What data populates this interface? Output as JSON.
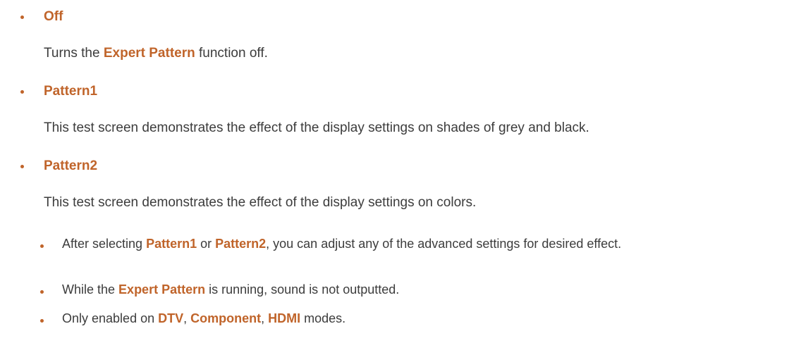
{
  "options": [
    {
      "title": "Off",
      "desc_pre": "Turns the ",
      "desc_hl": "Expert Pattern",
      "desc_post": " function off."
    },
    {
      "title": "Pattern1",
      "desc": "This test screen demonstrates the effect of the display settings on shades of grey and black."
    },
    {
      "title": "Pattern2",
      "desc": "This test screen demonstrates the effect of the display settings on colors."
    }
  ],
  "notes": [
    {
      "pre": "After selecting ",
      "hl1": "Pattern1",
      "mid": " or ",
      "hl2": "Pattern2",
      "post": ", you can adjust any of the advanced settings for desired effect."
    },
    {
      "pre": "While the ",
      "hl": "Expert Pattern",
      "post": " is running, sound is not outputted."
    },
    {
      "pre": "Only enabled on ",
      "hl1": "DTV",
      "sep1": ", ",
      "hl2": "Component",
      "sep2": ", ",
      "hl3": "HDMI",
      "post": " modes."
    }
  ],
  "colors": {
    "accent": "#c0642a",
    "text": "#3c3c3c"
  },
  "icons": {
    "bullet": "bullet-dot-icon"
  }
}
